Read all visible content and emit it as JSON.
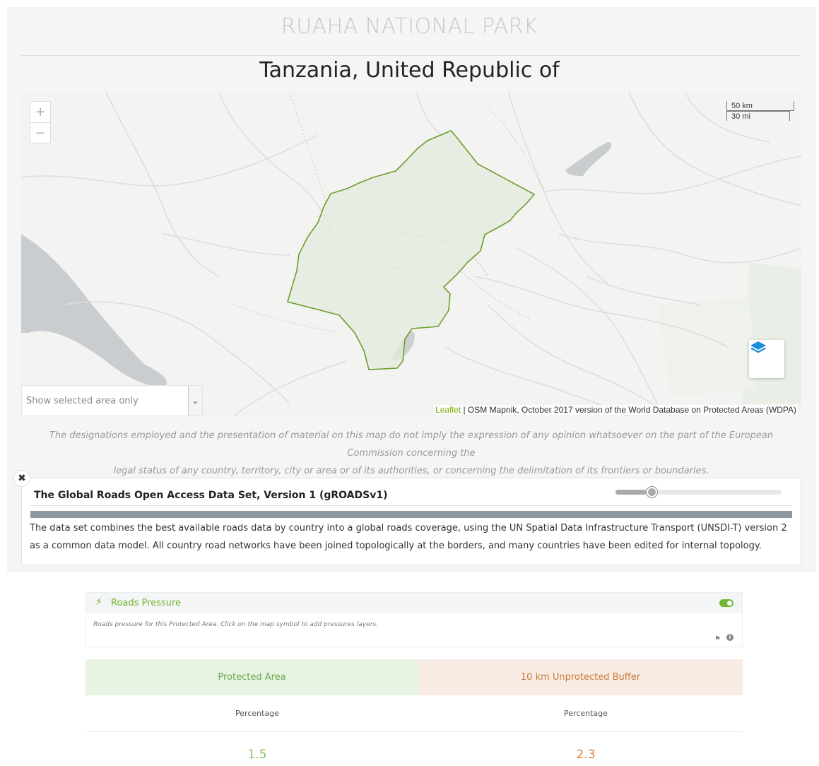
{
  "header": {
    "park_name": "RUAHA NATIONAL PARK",
    "country": "Tanzania, United Republic of"
  },
  "map": {
    "zoom_in": "+",
    "zoom_out": "−",
    "scale_metric": "50 km",
    "scale_imperial": "30 mi",
    "area_select": "Show selected area only",
    "attribution_link": "Leaflet",
    "attribution_text": " | OSM Mapnik, October 2017 version of the World Database on Protected Areas (WDPA)",
    "layers_icon": "layers-icon",
    "boundary_color": "#6b9e2f"
  },
  "disclaimer": {
    "line1": "The designations employed and the presentation of material on this map do not imply the expression of any opinion whatsoever on the part of the European Commission concerning the",
    "line2": "legal status of any country, territory, city or area or of its authorities, or concerning the delimitation of its frontiers or boundaries."
  },
  "layer_card": {
    "close": "✖",
    "title": "The Global Roads Open Access Data Set, Version 1 (gROADSv1)",
    "opacity": 0.2,
    "description": "The data set combines the best available roads data by country into a global roads coverage, using the UN Spatial Data Infrastructure Transport (UNSDI-T) version 2 as a common data model. All country road networks have been joined topologically at the borders, and many countries have been edited for internal topology."
  },
  "pressure": {
    "icon": "bolt-icon",
    "title": "Roads Pressure",
    "note": "Roads pressure for this Protected Area. Click on the map symbol to add pressures layers.",
    "toggle_on": true
  },
  "stats": {
    "protected_area": {
      "label": "Protected Area",
      "metric": "Percentage",
      "value": "1.5"
    },
    "buffer": {
      "label": "10 km Unprotected Buffer",
      "metric": "Percentage",
      "value": "2.3"
    }
  }
}
